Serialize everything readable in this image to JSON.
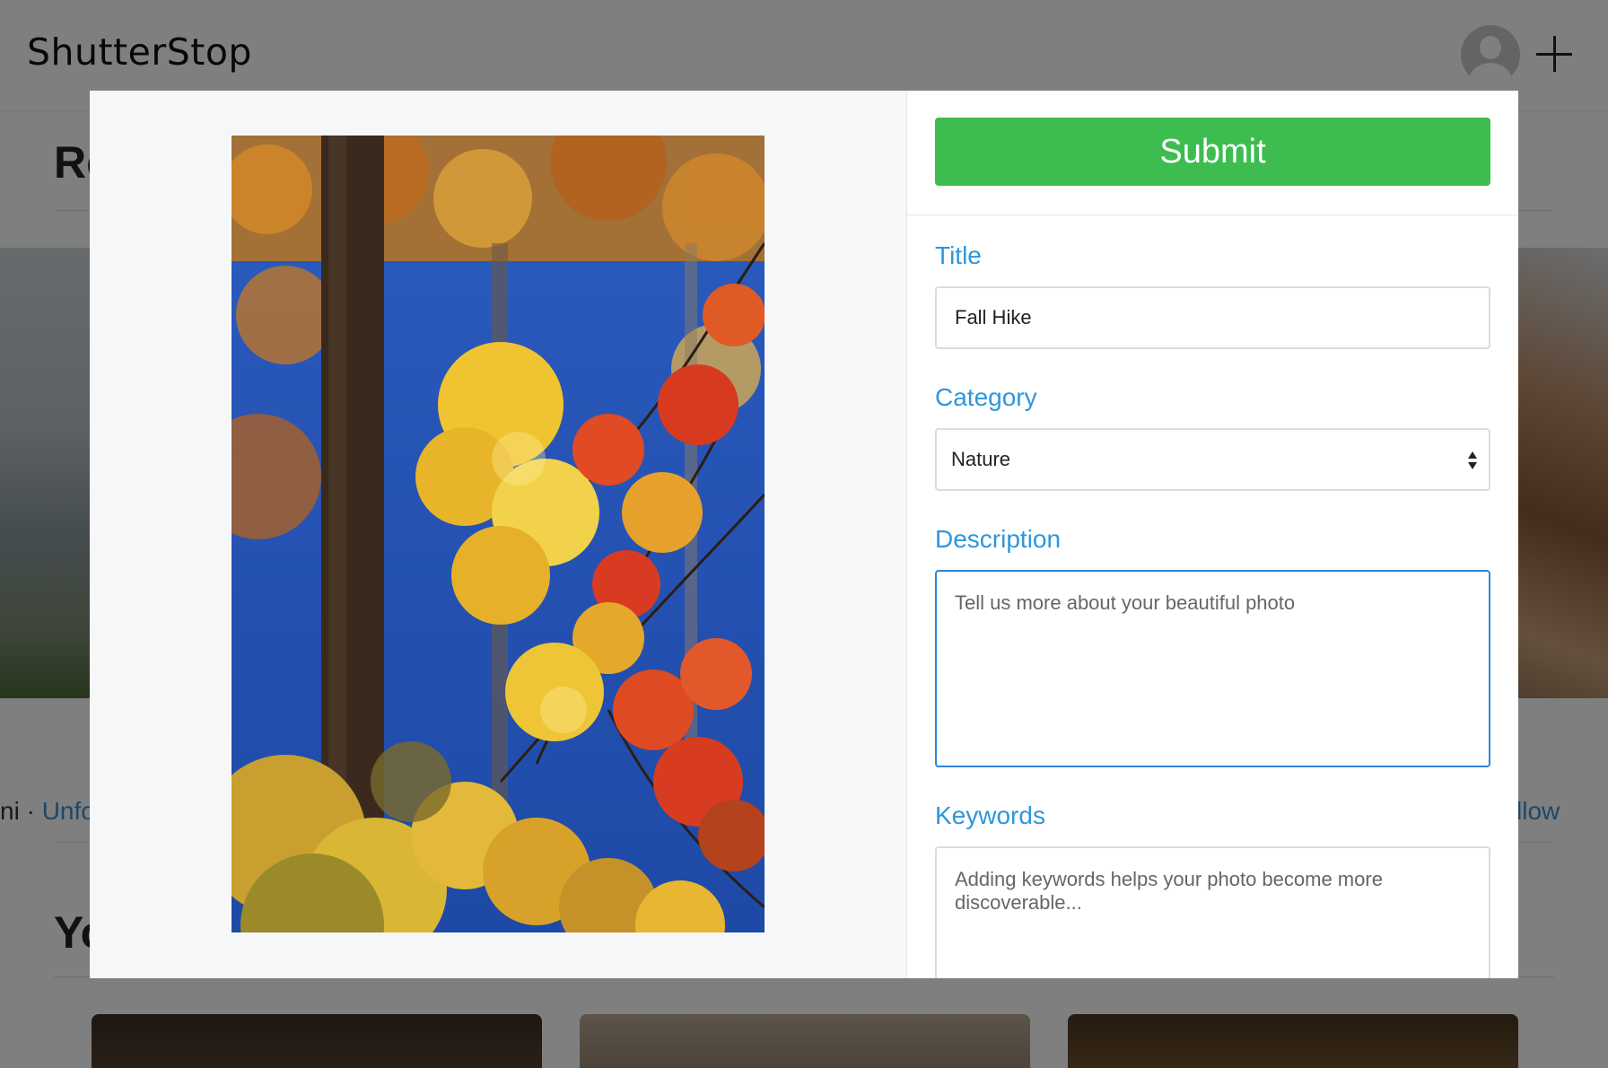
{
  "app": {
    "name": "ShutterStop"
  },
  "header": {
    "avatar_icon": "user-avatar-icon",
    "add_icon": "plus-icon"
  },
  "background": {
    "section_title_1": "Re",
    "section_title_2": "Yo",
    "meta_left_text": "ni",
    "meta_left_link": "Unfoll",
    "meta_right_link": "llow"
  },
  "modal": {
    "submit_label": "Submit",
    "photo_alt": "Autumn maple leaves against blue sky",
    "fields": {
      "title": {
        "label": "Title",
        "value": "Fall Hike"
      },
      "category": {
        "label": "Category",
        "value": "Nature"
      },
      "description": {
        "label": "Description",
        "placeholder": "Tell us more about your beautiful photo"
      },
      "keywords": {
        "label": "Keywords",
        "placeholder": "Adding keywords helps your photo become more discoverable..."
      }
    }
  },
  "colors": {
    "submit_green": "#3dbd50",
    "label_blue": "#2e96dc",
    "focus_blue": "#2d86d6",
    "link_blue": "#3a8fd8"
  }
}
